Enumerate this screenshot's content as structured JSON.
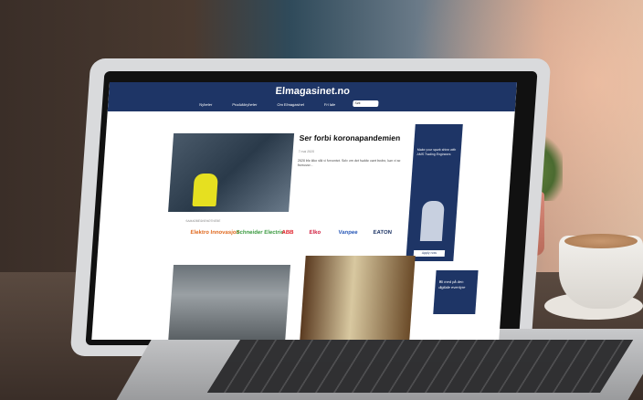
{
  "site": {
    "logo": "Elmagasinet.no",
    "nav": [
      "Nyheter",
      "Produktnyheter",
      "Om Elmagasinet",
      "Fri tale"
    ],
    "search_placeholder": "Søk"
  },
  "hero": {
    "title": "Ser forbi koronapandemien",
    "date": "7 mai 2020",
    "body": "2020 ble ikke slik vi forventet. Selv om det hadde vært bedre, kan vi se fremover..."
  },
  "partners": {
    "label": "SAMARBEIDSPARTNERE",
    "logos": [
      "Elektro Innovasjon",
      "Schneider Electric",
      "ABB",
      "Elko",
      "Vanpee",
      "EATON"
    ]
  },
  "ad_tall": {
    "text": "Make your spark shine with AMS Trading Engineers",
    "button": "Apply now"
  },
  "ad_small": {
    "text": "Bli med på den digitale eventyre"
  }
}
